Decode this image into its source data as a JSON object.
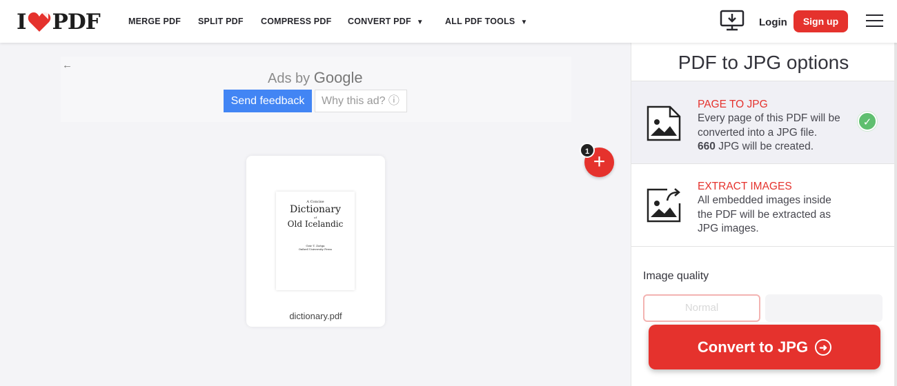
{
  "header": {
    "logo_left": "I",
    "logo_right": "PDF",
    "nav": [
      {
        "label": "MERGE PDF"
      },
      {
        "label": "SPLIT PDF"
      },
      {
        "label": "COMPRESS PDF"
      },
      {
        "label": "CONVERT PDF"
      },
      {
        "label": "ALL PDF TOOLS"
      }
    ],
    "login": "Login",
    "signup": "Sign up"
  },
  "ad": {
    "ads_by": "Ads by",
    "google": "Google",
    "send_feedback": "Send feedback",
    "why_ad": "Why this ad? ⓘ"
  },
  "file": {
    "name": "dictionary.pdf",
    "thumb_small": "A Concise",
    "thumb_title1": "Dictionary",
    "thumb_of": "of",
    "thumb_title2": "Old Icelandic",
    "thumb_credit1": "Geir T. Zoëga",
    "thumb_credit2": "Oxford University Press",
    "count_badge": "1"
  },
  "sidebar": {
    "title": "PDF to JPG options",
    "options": [
      {
        "title": "PAGE TO JPG",
        "desc1": "Every page of this PDF will be",
        "desc2": "converted into a JPG file.",
        "count": "660",
        "desc3": "JPG will be created.",
        "selected": true
      },
      {
        "title": "EXTRACT IMAGES",
        "desc1": "All embedded images inside",
        "desc2": "the PDF will be extracted as",
        "desc3": "JPG images.",
        "selected": false
      }
    ],
    "quality_label": "Image quality",
    "quality_normal": "Normal",
    "convert": "Convert to JPG"
  },
  "colors": {
    "brand": "#e5322d",
    "check": "#5fbf6f",
    "feedback_button": "#4285f4"
  }
}
